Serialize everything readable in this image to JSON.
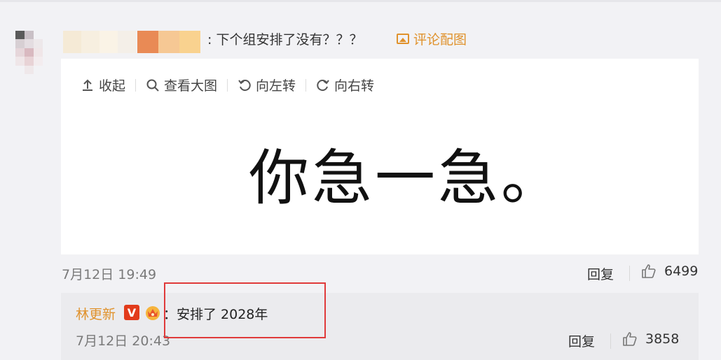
{
  "comment": {
    "text": ": 下个组安排了没有？？？",
    "pic_link_label": "评论配图"
  },
  "toolbar": {
    "collapse": "收起",
    "view_large": "查看大图",
    "rotate_left": "向左转",
    "rotate_right": "向右转"
  },
  "image_text": "你急一急。",
  "meta": {
    "time": "7月12日 19:49",
    "reply": "回复",
    "likes": "6499"
  },
  "sub_reply": {
    "user": "林更新",
    "badge": "V",
    "text": "：安排了  2028年",
    "time": "7月12日 20:43",
    "reply": "回复",
    "likes": "3858"
  },
  "colors": {
    "accent": "#e0922c",
    "highlight_box": "#e03a3a"
  }
}
